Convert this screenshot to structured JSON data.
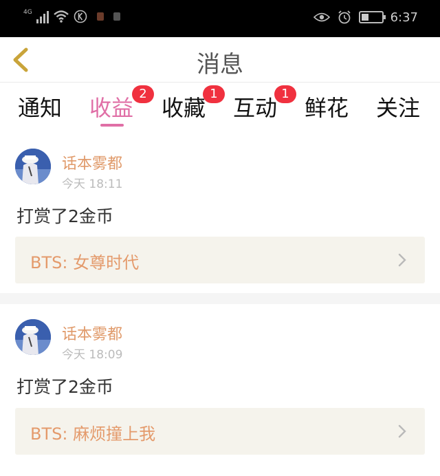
{
  "status_bar": {
    "network": "4G",
    "time": "6:37",
    "icons": [
      "signal-icon",
      "wifi-icon",
      "k-icon",
      "app-icon",
      "app-icon",
      "eye-icon",
      "alarm-icon",
      "battery-icon"
    ]
  },
  "header": {
    "title": "消息",
    "back_icon": "chevron-left-icon"
  },
  "tabs": [
    {
      "label": "通知",
      "badge": "",
      "active": false
    },
    {
      "label": "收益",
      "badge": "2",
      "active": true
    },
    {
      "label": "收藏",
      "badge": "1",
      "active": false
    },
    {
      "label": "互动",
      "badge": "1",
      "active": false
    },
    {
      "label": "鲜花",
      "badge": "",
      "active": false
    },
    {
      "label": "关注",
      "badge": "",
      "active": false
    }
  ],
  "messages": [
    {
      "user": "话本雾都",
      "time": "今天 18:11",
      "content": "打赏了2金币",
      "book": "BTS: 女尊时代"
    },
    {
      "user": "话本雾都",
      "time": "今天 18:09",
      "content": "打赏了2金币",
      "book": "BTS: 麻烦撞上我"
    }
  ],
  "colors": {
    "accent": "#e06fa6",
    "badge": "#f0313f",
    "username": "#e09a6a",
    "book_bg": "#f5f3ec",
    "book_text": "#e49a6b",
    "back_arrow": "#c9a43a"
  }
}
